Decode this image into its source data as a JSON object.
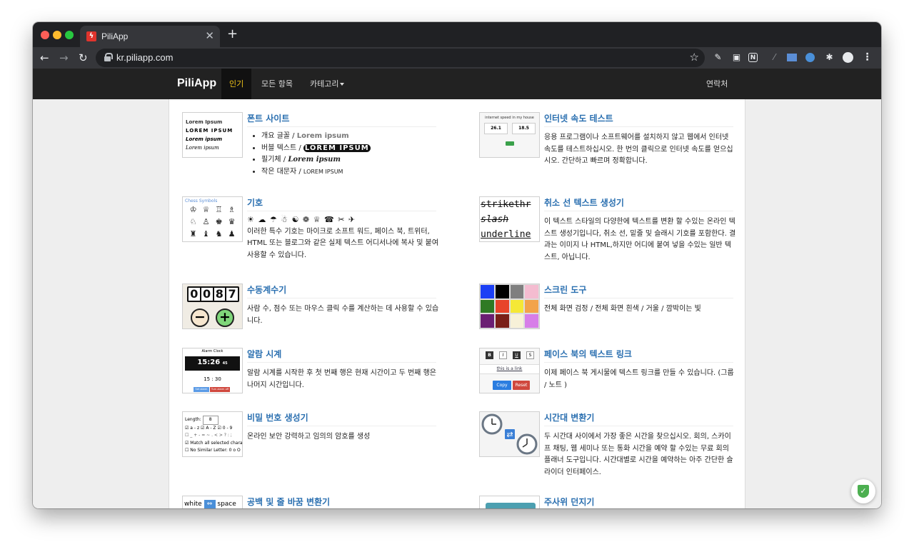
{
  "browser": {
    "tab_title": "PiliApp",
    "tab_close": "✕",
    "new_tab": "+",
    "url": "kr.piliapp.com"
  },
  "navbar": {
    "brand": "PiliApp",
    "links": [
      "인기",
      "모든 항목",
      "카테고리"
    ],
    "contact": "연락처"
  },
  "tools": {
    "font": {
      "title": "폰트 사이트",
      "bullets": [
        {
          "label": "개요 글꼴 / ",
          "sample": "Lorem ipsum"
        },
        {
          "label": "버블 텍스트 / ",
          "sample": "LOREM IPSUM"
        },
        {
          "label": "필기체 / ",
          "sample": "Lorem ipsum"
        },
        {
          "label": "작은 대문자 / ",
          "sample": "LOREM IPSUM"
        }
      ],
      "thumb_lines": [
        "Lorem Ipsum",
        "LOREM IPSUM",
        "Lorem ipsum",
        "Lorem ipsum"
      ]
    },
    "speed": {
      "title": "인터넷 속도 테스트",
      "desc": "응용 프로그램이나 소프트웨어를 설치하지 않고 웹에서 인터넷 속도를 테스트하십시오. 한 번의 클릭으로 인터넷 속도를 얻으십시오. 간단하고 빠르며 정확합니다.",
      "thumb_header": "internet speed in my house",
      "thumb_values": [
        "26.1",
        "18.5"
      ]
    },
    "symbols": {
      "title": "기호",
      "symbol_line": "☀ ☁ ☂ ☃ ☯ ❁ ♕ ☎ ✂ ✈",
      "desc": "이러한 특수 기호는 마이크로 소프트 워드, 페이스 북, 트위터, HTML 또는 블로그와 같은 실제 텍스트 어디서나에 복사 및 붙여 사용할 수 있습니다.",
      "thumb_header": "Chess Symbols",
      "chess": [
        "♔",
        "♕",
        "♖",
        "♗",
        "♘",
        "♙",
        "♚",
        "♛",
        "♜",
        "♝",
        "♞",
        "♟"
      ]
    },
    "strike": {
      "title": "취소 선 텍스트 생성기",
      "desc": "이 텍스트 스타일의 다양한에 텍스트를 변환 할 수있는 온라인 텍스트 생성기입니다, 취소 선, 밑줄 및 슬래시 기호를 포함한다. 결과는 이미지 나 HTML,하지만 어디에 붙여 넣을 수있는 일반 텍스트, 아닙니다.",
      "thumb_lines": [
        "strikethr",
        "slash",
        "underline"
      ]
    },
    "counter": {
      "title": "수동계수기",
      "desc": "사람 수, 점수 또는 마우스 클릭 수를 계산하는 데 사용할 수 있습니다.",
      "thumb_digits": [
        "0",
        "0",
        "8",
        "7"
      ],
      "minus": "−",
      "plus": "+"
    },
    "screen": {
      "title": "스크린 도구",
      "desc": "전체 화면 검정 / 전체 화면 흰색 / 거울 / 깜박이는 빛",
      "colors": [
        "#1b3ff5",
        "#000000",
        "#7f7f7f",
        "#f4bcd0",
        "#2f7a24",
        "#e8442a",
        "#f5e836",
        "#f2a34a",
        "#6b1f73",
        "#7a1f18",
        "#f7f1d8",
        "#d77ee8"
      ]
    },
    "alarm": {
      "title": "알람 시계",
      "desc": "알람 시계를 시작한 후 첫 번째 행은 현재 시간이고 두 번째 행은 나머지 시간입니다.",
      "thumb_header": "Alarm Clock",
      "thumb_time": "15:26",
      "thumb_seconds": "45",
      "thumb_alarm": "15 : 30",
      "thumb_buttons": [
        "Set alarm",
        "Turn alarm off"
      ]
    },
    "fblink": {
      "title": "페이스 북의 텍스트 링크",
      "desc": "이제 페이스 북 게시물에 텍스트 링크를 만들 수 있습니다. (그룹 / 노트 )",
      "thumb_format": [
        "B",
        "I",
        "U",
        "S"
      ],
      "thumb_link": "this is a link",
      "thumb_buttons": [
        "Copy",
        "Reset"
      ]
    },
    "password": {
      "title": "비밀 번호 생성기",
      "desc": "온라인 보안 강력하고 임의의 암호를 생성",
      "thumb_length_label": "Length:",
      "thumb_length_value": "8",
      "thumb_options": [
        "a - z",
        "A - Z",
        "0 - 9",
        "_ + - = ~ . < > ? : ;",
        "Match all selected chara",
        "No Similar Letter: 0 o O"
      ]
    },
    "timezone": {
      "title": "시간대 변환기",
      "desc": "두 시간대 사이에서 가장 좋은 시간을 찾으십시오. 회의, 스카이프 채팅, 웹 세미나 또는 통화 시간을 예약 할 수있는 무료 회의 플래너 도구입니다. 시간대별로 시간을 예약하는 아주 간단한 슬라이더 인터페이스."
    },
    "whitespace": {
      "title": "공백 및 줄 바꿈 변환기",
      "thumb_words": [
        "white",
        "space"
      ]
    },
    "dice": {
      "title": "주사위 던지기"
    }
  }
}
